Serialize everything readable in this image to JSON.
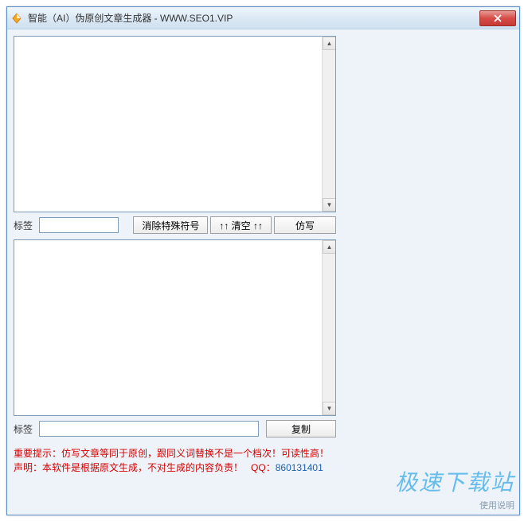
{
  "window": {
    "title": "智能（AI）伪原创文章生成器 - WWW.SEO1.VIP"
  },
  "labels": {
    "tag_top": "标签",
    "tag_bottom": "标签"
  },
  "buttons": {
    "remove_special": "消除特殊符号",
    "clear": "↑↑ 清空 ↑↑",
    "rewrite": "仿写",
    "copy": "复制"
  },
  "inputs": {
    "source_text": "",
    "result_text": "",
    "tag_top_value": "",
    "tag_bottom_value": ""
  },
  "notice": {
    "line1_label": "重要提示：",
    "line1_body": "仿写文章等同于原创，跟同义词替换不是一个档次！可读性高！",
    "line2_label": "声明：",
    "line2_body": "本软件是根据原文生成，不对生成的内容负责！",
    "qq_label": "QQ：",
    "qq_number": "860131401"
  },
  "overlay": {
    "brand": "极速下载站",
    "usage_hint": "使用说明"
  }
}
